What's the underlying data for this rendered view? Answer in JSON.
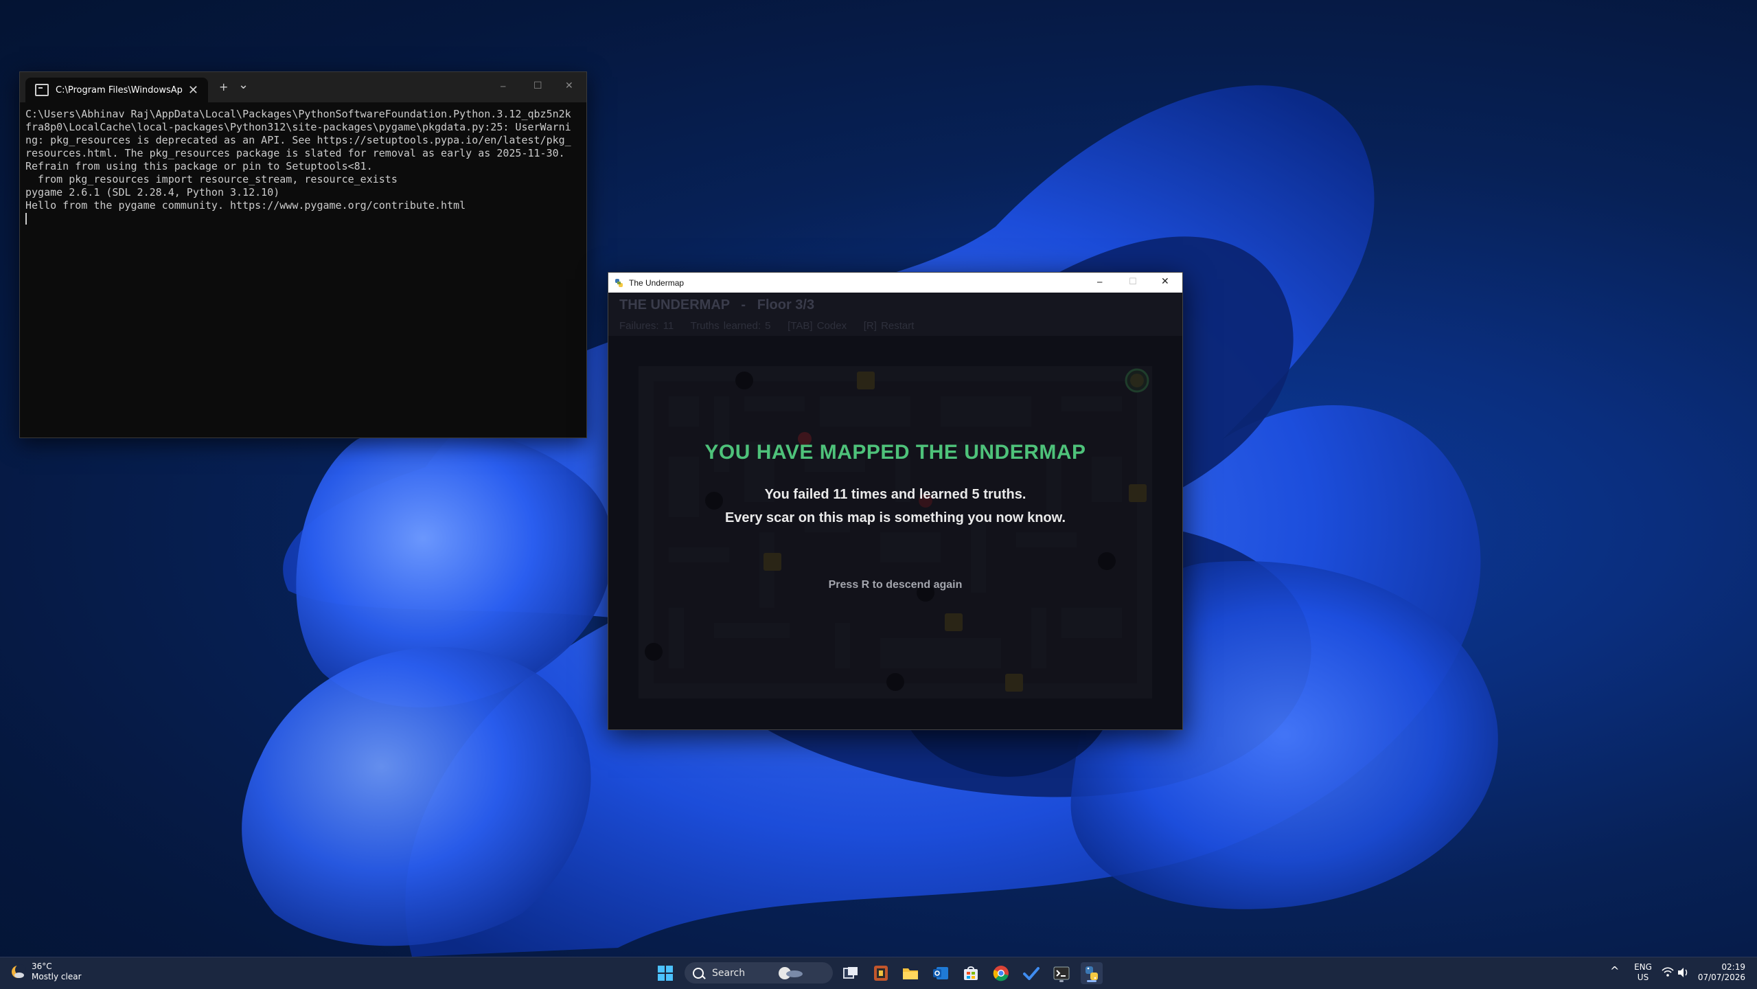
{
  "terminal": {
    "tab_title": "C:\\Program Files\\WindowsAp",
    "new_tab": "+",
    "dropdown": "⌄",
    "minimize": "─",
    "maximize": "☐",
    "close": "✕",
    "lines": [
      "C:\\Users\\Abhinav Raj\\AppData\\Local\\Packages\\PythonSoftwareFoundation.Python.3.12_qbz5n2k",
      "fra8p0\\LocalCache\\local-packages\\Python312\\site-packages\\pygame\\pkgdata.py:25: UserWarni",
      "ng: pkg_resources is deprecated as an API. See https://setuptools.pypa.io/en/latest/pkg_",
      "resources.html. The pkg_resources package is slated for removal as early as 2025-11-30.",
      "Refrain from using this package or pin to Setuptools<81.",
      "  from pkg_resources import resource_stream, resource_exists",
      "pygame 2.6.1 (SDL 2.28.4, Python 3.12.10)",
      "Hello from the pygame community. https://www.pygame.org/contribute.html"
    ]
  },
  "game": {
    "window_title": "The Undermap",
    "minimize": "─",
    "maximize": "☐",
    "close": "✕",
    "hud_title": "THE UNDERMAP   -   Floor 3/3",
    "hud_stats": "Failures: 11    Truths learned: 5    [TAB] Codex    [R] Restart",
    "win_title": "YOU HAVE MAPPED THE UNDERMAP",
    "win_line1": "You failed 11 times and learned 5 truths.",
    "win_line2": "Every scar on this map is something you now know.",
    "win_prompt": "Press R to descend again",
    "colors": {
      "accent_green": "#4ec27a",
      "hazard_red": "#c0392b",
      "relic_gold": "#6b5a1e"
    }
  },
  "taskbar": {
    "weather_temp": "36°C",
    "weather_desc": "Mostly clear",
    "search_placeholder": "Search",
    "lang_top": "ENG",
    "lang_bottom": "US",
    "time": "02:19",
    "date": "07/07/2026",
    "tray_chevron": "^",
    "pinned": [
      "windows-start-icon",
      "task-view-icon",
      "app-icon",
      "file-explorer-icon",
      "outlook-icon",
      "store-icon",
      "chrome-icon",
      "todo-icon",
      "terminal-icon",
      "python-icon"
    ]
  }
}
